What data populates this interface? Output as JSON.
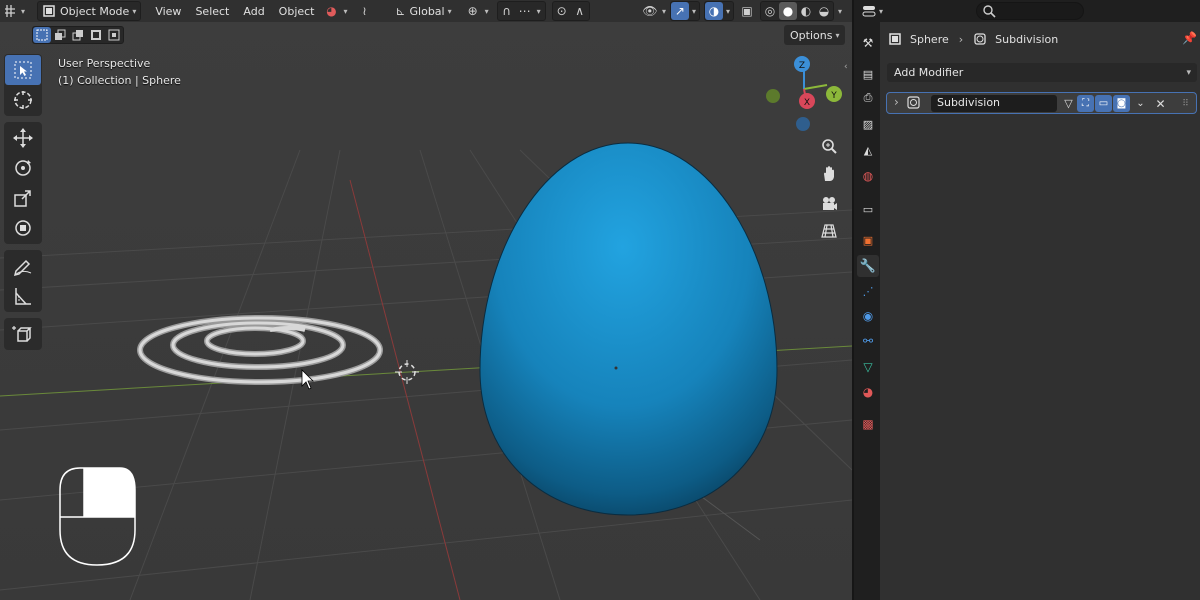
{
  "viewport": {
    "header": {
      "mode_label": "Object Mode",
      "menu": [
        "View",
        "Select",
        "Add",
        "Object"
      ],
      "transform_orientation": "Global"
    },
    "options_label": "Options",
    "overlay": {
      "perspective": "User Perspective",
      "collection": "(1) Collection | Sphere"
    },
    "gizmo": {
      "z": "Z",
      "y": "Y",
      "x": "X"
    },
    "objects": [
      "coil",
      "egg-sphere"
    ]
  },
  "properties": {
    "breadcrumb": {
      "object": "Sphere",
      "modifier": "Subdivision"
    },
    "add_modifier_label": "Add Modifier",
    "modifier": {
      "name": "Subdivision"
    }
  },
  "colors": {
    "accent": "#4772b3",
    "egg": "#1a8ac4",
    "axis_x": "#d9475a",
    "axis_y": "#8cb83a",
    "axis_z": "#3b8fd8"
  }
}
